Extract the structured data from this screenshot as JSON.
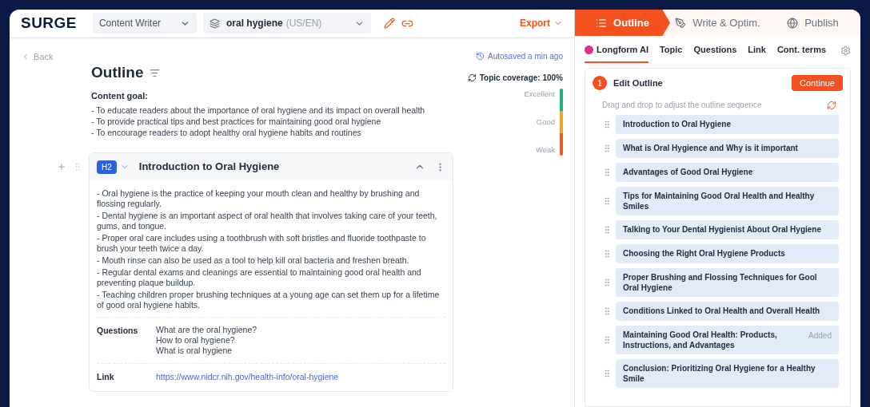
{
  "header": {
    "logo": "SURGE",
    "role_select": "Content Writer",
    "keyword_select": {
      "keyword": "oral hygiene",
      "locale": "(US/EN)"
    },
    "export": "Export"
  },
  "stages": [
    {
      "label": "Outline",
      "selected": true
    },
    {
      "label": "Write & Optim.",
      "selected": false
    },
    {
      "label": "Publish",
      "selected": false
    }
  ],
  "editor": {
    "back": "Back",
    "autosave": "Autosaved a min ago",
    "coverage": "Topic coverage: 100%",
    "coverage_levels": [
      "Excellent",
      "Good",
      "Weak"
    ],
    "title": "Outline",
    "goal_label": "Content goal:",
    "goals": [
      "- To educate readers about the importance of oral hygiene and its impact on overall health",
      "- To provide practical tips and best practices for maintaining good oral hygiene",
      "- To encourage readers to adopt healthy oral hygiene habits and routines"
    ],
    "section": {
      "level": "H2",
      "title": "Introduction to Oral Hygiene",
      "expanded": true,
      "points": [
        "- Oral hygiene is the practice of keeping your mouth clean and healthy by brushing and flossing regularly.",
        "- Dental hygiene is an important aspect of oral health that involves taking care of your teeth, gums, and tongue.",
        "- Proper oral care includes using a toothbrush with soft bristles and fluoride toothpaste to brush your teeth twice a day.",
        "- Mouth rinse can also be used as a tool to help kill oral bacteria and freshen breath.",
        "- Regular dental exams and cleanings are essential to maintaining good oral health and preventing plaque buildup.",
        "- Teaching children proper brushing techniques at a young age can set them up for a lifetime of good oral hygiene habits."
      ],
      "questions_label": "Questions",
      "questions": [
        "What are the oral hygiene?",
        "How to oral hygiene?",
        "What is oral hygiene"
      ],
      "link_label": "Link",
      "link": "https://www.nidcr.nih.gov/health-info/oral-hygiene"
    }
  },
  "tools_tabs": [
    {
      "label": "Longform AI",
      "selected": true
    },
    {
      "label": "Topic",
      "selected": false
    },
    {
      "label": "Questions",
      "selected": false
    },
    {
      "label": "Link",
      "selected": false
    },
    {
      "label": "Cont. terms",
      "selected": false
    }
  ],
  "edit_outline": {
    "step": "1",
    "title": "Edit Outline",
    "continue": "Continue",
    "hint": "Drag and drop to adjust the outline sequence",
    "items": [
      {
        "text": "Introduction to Oral Hygiene"
      },
      {
        "text": "What is Oral Hygience and Why is it important"
      },
      {
        "text": "Advantages of Good Oral Hygiene"
      },
      {
        "text": "Tips for Maintaining Good Oral Health and Healthy Smiles"
      },
      {
        "text": "Talking to Your Dental Hygienist About Oral Hygiene"
      },
      {
        "text": "Choosing the Right Oral Hygiene Products"
      },
      {
        "text": "Proper Brushing and Flossing Techniques for Gool Oral Hygiene"
      },
      {
        "text": "Conditions Linked to Oral Health and Overall Health"
      },
      {
        "text": "Maintaining Good Oral Health: Products, Instructions, and Advantages",
        "badge": "Added"
      },
      {
        "text": "Conclusion: Prioritizing Oral Hygiene for a Healthy Smile"
      }
    ]
  }
}
